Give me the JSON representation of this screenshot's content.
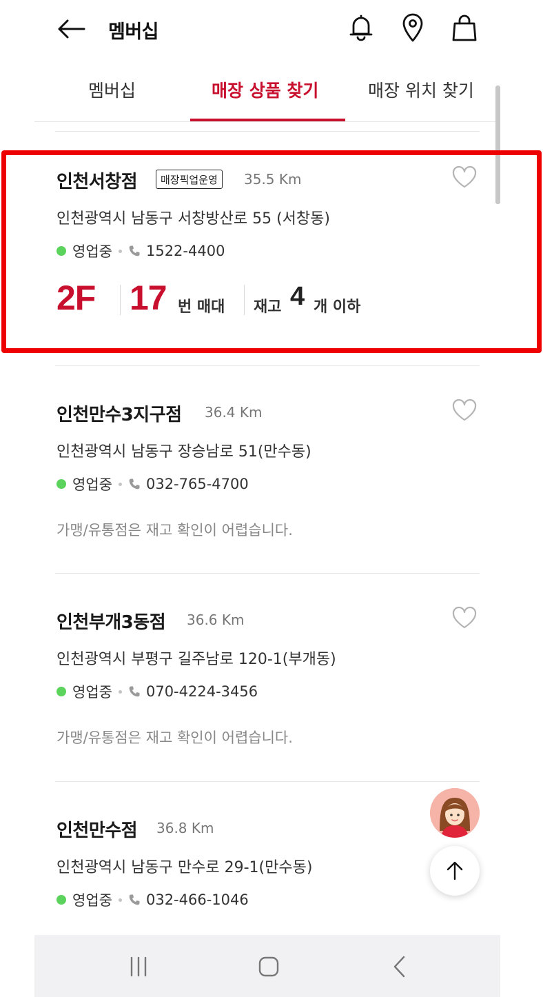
{
  "header": {
    "title": "멤버십",
    "back_icon": "arrow-left-icon",
    "icons": [
      "bell-icon",
      "location-pin-icon",
      "shopping-bag-icon"
    ]
  },
  "tabs": [
    {
      "label": "멤버십",
      "active": false
    },
    {
      "label": "매장 상품 찾기",
      "active": true
    },
    {
      "label": "매장 위치 찾기",
      "active": false
    }
  ],
  "colors": {
    "accent": "#c8102e",
    "open_status": "#5cd35c",
    "highlight_box": "#ee0000"
  },
  "stores": [
    {
      "name": "인천서창점",
      "badge": "매장픽업운영",
      "distance": "35.5 Km",
      "address": "인천광역시 남동구 서창방산로 55 (서창동)",
      "status": "영업중",
      "phone": "1522-4400",
      "stock": {
        "floor": "2F",
        "shelf_number": "17",
        "shelf_unit": "번 매대",
        "stock_label": "재고",
        "stock_count": "4",
        "stock_suffix": "개 이하"
      }
    },
    {
      "name": "인천만수3지구점",
      "distance": "36.4 Km",
      "address": "인천광역시 남동구 장승남로 51(만수동)",
      "status": "영업중",
      "phone": "032-765-4700",
      "note": "가맹/유통점은 재고 확인이 어렵습니다."
    },
    {
      "name": "인천부개3동점",
      "distance": "36.6 Km",
      "address": "인천광역시 부평구 길주남로 120-1(부개동)",
      "status": "영업중",
      "phone": "070-4224-3456",
      "note": "가맹/유통점은 재고 확인이 어렵습니다."
    },
    {
      "name": "인천만수점",
      "distance": "36.8 Km",
      "address": "인천광역시 남동구 만수로 29-1(만수동)",
      "status": "영업중",
      "phone": "032-466-1046"
    }
  ],
  "floating": {
    "assistant_icon": "assistant-avatar-icon",
    "scroll_top_icon": "arrow-up-icon"
  },
  "system_nav": [
    "recent-apps-icon",
    "home-icon",
    "back-icon"
  ]
}
